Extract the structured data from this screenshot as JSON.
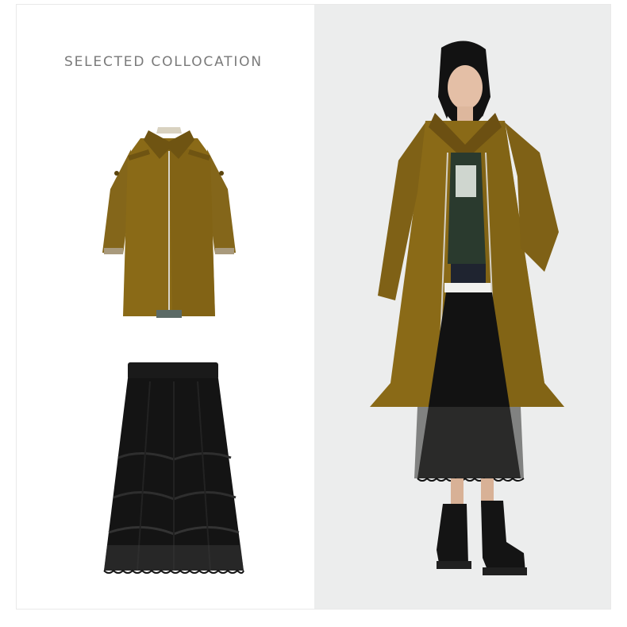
{
  "header": {
    "title": "SELECTED COLLOCATION"
  },
  "products": [
    {
      "icon": "mustard-coat-image"
    },
    {
      "icon": "black-lace-skirt-image"
    }
  ],
  "model": {
    "icon": "model-photo"
  },
  "colors": {
    "coat": "#8a6a17",
    "coat_dark": "#6b5010",
    "skirt": "#141414",
    "panel_bg": "#eceded",
    "title_text": "#7a7a7a"
  }
}
